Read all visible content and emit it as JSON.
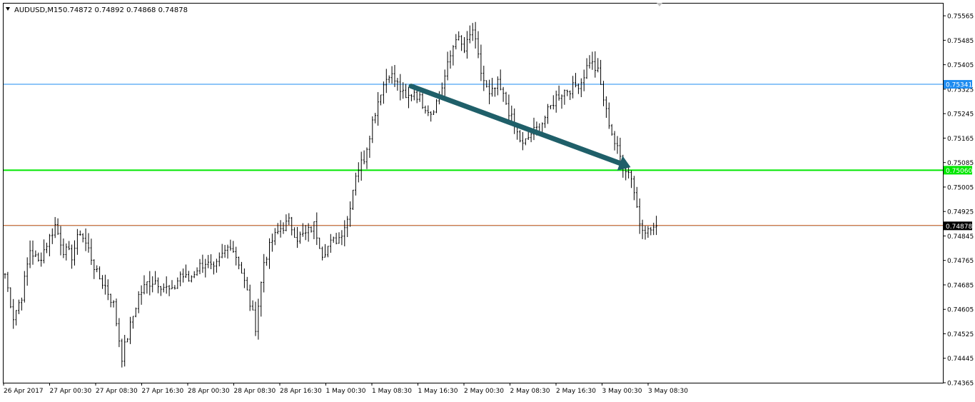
{
  "chart_data": {
    "type": "candlestick",
    "symbol_header": "AUDUSD,M15",
    "ohlc_header": "0.74872 0.74892 0.74868 0.74878",
    "y_ticks": [
      "0.75565",
      "0.75485",
      "0.75405",
      "0.75325",
      "0.75245",
      "0.75165",
      "0.75085",
      "0.75005",
      "0.74925",
      "0.74845",
      "0.74765",
      "0.74685",
      "0.74605",
      "0.74525",
      "0.74445",
      "0.74365"
    ],
    "x_ticks": [
      "26 Apr 2017",
      "27 Apr 00:30",
      "27 Apr 08:30",
      "27 Apr 16:30",
      "28 Apr 00:30",
      "28 Apr 08:30",
      "28 Apr 16:30",
      "1 May 00:30",
      "1 May 08:30",
      "1 May 16:30",
      "2 May 00:30",
      "2 May 08:30",
      "2 May 16:30",
      "3 May 00:30",
      "3 May 08:30"
    ],
    "ylim": [
      0.74365,
      0.75605
    ],
    "horizontal_lines": [
      {
        "price": 0.75341,
        "label": "0.75341",
        "color": "#1e8cf0"
      },
      {
        "price": 0.7506,
        "label": "0.75060",
        "color": "#00e600"
      },
      {
        "price": 0.74878,
        "label": "0.74878",
        "color": "#000000"
      }
    ],
    "support_line": {
      "price": 0.7488,
      "color": "#e07030"
    },
    "arrow": {
      "from": [
        "1 May 08:30",
        0.75335
      ],
      "to": [
        "3 May 00:30",
        0.7507
      ],
      "color": "#1f5f69"
    },
    "anchors": [
      [
        0,
        0.7472
      ],
      [
        3,
        0.7458
      ],
      [
        6,
        0.7465
      ],
      [
        9,
        0.748
      ],
      [
        12,
        0.7476
      ],
      [
        15,
        0.7482
      ],
      [
        18,
        0.7488
      ],
      [
        21,
        0.748
      ],
      [
        24,
        0.7478
      ],
      [
        27,
        0.7486
      ],
      [
        30,
        0.748
      ],
      [
        33,
        0.7472
      ],
      [
        36,
        0.7468
      ],
      [
        39,
        0.7462
      ],
      [
        42,
        0.7445
      ],
      [
        45,
        0.7455
      ],
      [
        48,
        0.7465
      ],
      [
        51,
        0.7469
      ],
      [
        54,
        0.747
      ],
      [
        57,
        0.7468
      ],
      [
        60,
        0.7466
      ],
      [
        63,
        0.7472
      ],
      [
        66,
        0.747
      ],
      [
        69,
        0.7474
      ],
      [
        72,
        0.7476
      ],
      [
        75,
        0.7473
      ],
      [
        78,
        0.7478
      ],
      [
        81,
        0.7482
      ],
      [
        84,
        0.7476
      ],
      [
        87,
        0.7466
      ],
      [
        90,
        0.7455
      ],
      [
        93,
        0.7476
      ],
      [
        96,
        0.7483
      ],
      [
        99,
        0.7487
      ],
      [
        102,
        0.7489
      ],
      [
        105,
        0.7484
      ],
      [
        108,
        0.7485
      ],
      [
        111,
        0.7488
      ],
      [
        114,
        0.7479
      ],
      [
        117,
        0.7482
      ],
      [
        120,
        0.7484
      ],
      [
        123,
        0.749
      ],
      [
        126,
        0.7505
      ],
      [
        129,
        0.751
      ],
      [
        132,
        0.7522
      ],
      [
        135,
        0.7532
      ],
      [
        138,
        0.7538
      ],
      [
        141,
        0.7534
      ],
      [
        144,
        0.7529
      ],
      [
        147,
        0.7532
      ],
      [
        150,
        0.7528
      ],
      [
        153,
        0.7525
      ],
      [
        156,
        0.753
      ],
      [
        159,
        0.754
      ],
      [
        162,
        0.755
      ],
      [
        165,
        0.7545
      ],
      [
        168,
        0.7552
      ],
      [
        171,
        0.7538
      ],
      [
        174,
        0.753
      ],
      [
        177,
        0.7534
      ],
      [
        180,
        0.7528
      ],
      [
        183,
        0.752
      ],
      [
        186,
        0.7514
      ],
      [
        189,
        0.7518
      ],
      [
        192,
        0.752
      ],
      [
        195,
        0.7525
      ],
      [
        198,
        0.753
      ],
      [
        201,
        0.7532
      ],
      [
        204,
        0.7533
      ],
      [
        207,
        0.7535
      ],
      [
        210,
        0.7542
      ],
      [
        213,
        0.7538
      ],
      [
        216,
        0.7525
      ],
      [
        219,
        0.7515
      ],
      [
        222,
        0.7508
      ],
      [
        225,
        0.7504
      ],
      [
        228,
        0.7489
      ],
      [
        231,
        0.7486
      ],
      [
        234,
        0.74878
      ]
    ]
  }
}
